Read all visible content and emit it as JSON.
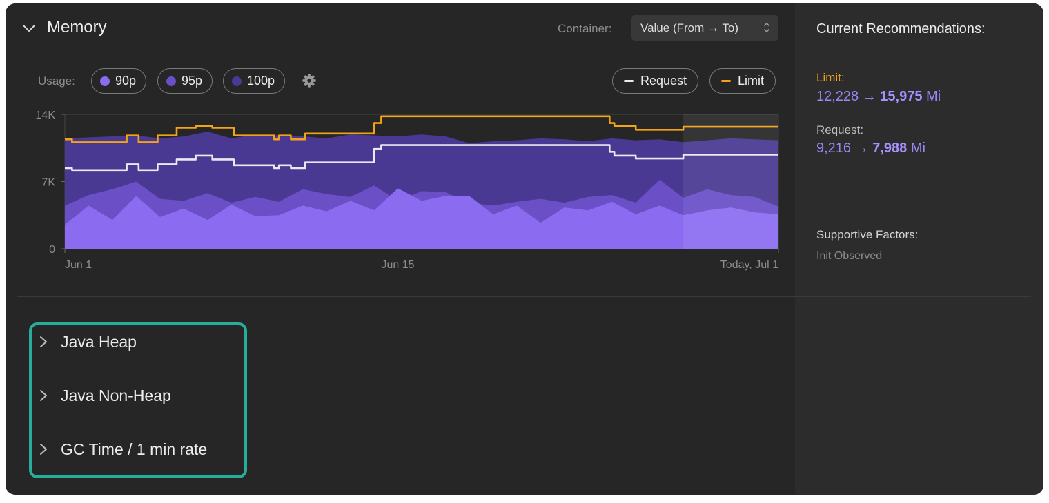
{
  "header": {
    "title": "Memory",
    "container_label": "Container:",
    "container_select_value": "Value (From → To)"
  },
  "usage": {
    "label": "Usage:",
    "pills": [
      {
        "label": "90p",
        "color": "#8b6cf0"
      },
      {
        "label": "95p",
        "color": "#6a4fc7"
      },
      {
        "label": "100p",
        "color": "#4a3993"
      }
    ]
  },
  "legend": {
    "request_label": "Request",
    "limit_label": "Limit",
    "request_color": "#e9e9f2",
    "limit_color": "#f5a316"
  },
  "chart_data": {
    "type": "area",
    "ylim": [
      0,
      14000
    ],
    "y_ticks": [
      "14K",
      "7K",
      "0"
    ],
    "x_ticks": [
      "Jun 1",
      "Jun 15",
      "Today, Jul 1"
    ],
    "x_range": [
      0,
      30
    ],
    "grid": true,
    "highlight_from": 26,
    "series": [
      {
        "name": "100p",
        "color": "#4a3993",
        "x": [
          0,
          1,
          2,
          3,
          4,
          5,
          6,
          7,
          8,
          9,
          10,
          11,
          12,
          13,
          14,
          15,
          16,
          17,
          18,
          19,
          20,
          21,
          22,
          23,
          24,
          25,
          26,
          27,
          28,
          29,
          30
        ],
        "y": [
          11500,
          11600,
          11700,
          11800,
          11500,
          11700,
          12200,
          11500,
          11900,
          11800,
          11700,
          11500,
          11900,
          11800,
          11700,
          11900,
          11700,
          11000,
          11200,
          11300,
          11500,
          11400,
          11200,
          11500,
          11300,
          11400,
          11100,
          11300,
          11500,
          11400,
          11300
        ]
      },
      {
        "name": "95p",
        "color": "#6a4fc7",
        "x": [
          0,
          1,
          2,
          3,
          4,
          5,
          6,
          7,
          8,
          9,
          10,
          11,
          12,
          13,
          14,
          15,
          16,
          17,
          18,
          19,
          20,
          21,
          22,
          23,
          24,
          25,
          26,
          27,
          28,
          29,
          30
        ],
        "y": [
          4500,
          5600,
          6200,
          7000,
          5200,
          5000,
          5800,
          4800,
          5400,
          4900,
          6200,
          5700,
          5400,
          6600,
          5000,
          6000,
          5900,
          4800,
          4500,
          4900,
          5200,
          4800,
          5400,
          5600,
          4800,
          7200,
          5300,
          6200,
          5600,
          5400,
          4400
        ]
      },
      {
        "name": "90p",
        "color": "#8b6cf0",
        "x": [
          0,
          1,
          2,
          3,
          4,
          5,
          6,
          7,
          8,
          9,
          10,
          11,
          12,
          13,
          14,
          15,
          16,
          17,
          18,
          19,
          20,
          21,
          22,
          23,
          24,
          25,
          26,
          27,
          28,
          29,
          30
        ],
        "y": [
          2500,
          4500,
          3000,
          5500,
          3300,
          4200,
          3000,
          4600,
          3400,
          3500,
          4500,
          3900,
          5000,
          4000,
          6300,
          5000,
          5500,
          5500,
          3600,
          4500,
          2700,
          4300,
          4000,
          4900,
          3600,
          4500,
          3500,
          4000,
          4300,
          3800,
          3600
        ]
      },
      {
        "name": "Limit",
        "color": "#f5a316",
        "step": true,
        "x": [
          0,
          0.3,
          2.3,
          2.6,
          3.1,
          3.9,
          4.7,
          5.5,
          6.2,
          7.1,
          7.6,
          8.8,
          9.0,
          9.5,
          10.1,
          12.8,
          13.0,
          13.3,
          22.9,
          23.1,
          24.0,
          26.0,
          30
        ],
        "y": [
          11400,
          11100,
          11100,
          11800,
          11100,
          11800,
          12600,
          12800,
          12600,
          11800,
          11800,
          11400,
          11800,
          11400,
          12000,
          12000,
          13100,
          13800,
          13100,
          12800,
          12400,
          12700,
          12700
        ]
      },
      {
        "name": "Request",
        "color": "#e9e9f2",
        "step": true,
        "x": [
          0,
          0.3,
          2.3,
          2.6,
          3.1,
          3.9,
          4.7,
          5.5,
          6.2,
          7.1,
          7.6,
          8.8,
          9.0,
          9.5,
          10.1,
          12.8,
          13.0,
          13.3,
          22.9,
          23.1,
          24.0,
          26.0,
          30
        ],
        "y": [
          8400,
          8200,
          8200,
          8800,
          8200,
          8800,
          9300,
          9700,
          9300,
          8700,
          8700,
          8400,
          8700,
          8400,
          9000,
          9000,
          10400,
          10800,
          10100,
          9700,
          9400,
          9800,
          9800
        ]
      }
    ]
  },
  "recommendations": {
    "title": "Current Recommendations:",
    "limit_label": "Limit:",
    "limit_from": "12,228",
    "limit_arrow": "→",
    "limit_to": "15,975",
    "limit_unit": "Mi",
    "request_label": "Request:",
    "request_from": "9,216",
    "request_arrow": "→",
    "request_to": "7,988",
    "request_unit": "Mi",
    "supportive_label": "Supportive Factors:",
    "supportive_value": "Init Observed",
    "limit_color": "#f5a316"
  },
  "metrics": [
    {
      "label": "Java Heap"
    },
    {
      "label": "Java Non-Heap"
    },
    {
      "label": "GC Time / 1 min rate"
    }
  ],
  "highlight_color": "#27ad9b"
}
